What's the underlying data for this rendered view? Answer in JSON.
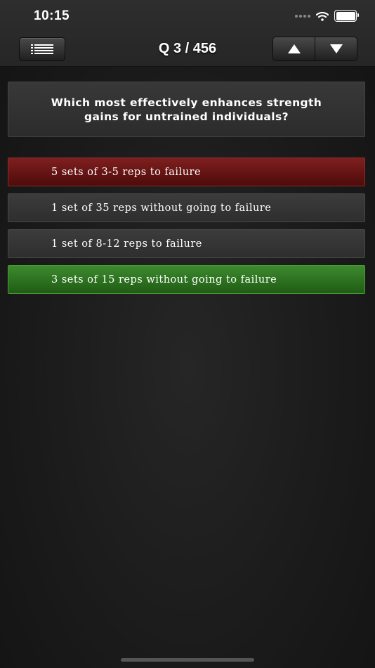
{
  "status_bar": {
    "time": "10:15",
    "icons": [
      "signal-dots-icon",
      "wifi-icon",
      "battery-icon"
    ]
  },
  "toolbar": {
    "menu_icon": "list-icon",
    "counter": "Q 3 / 456",
    "prev_icon": "up-arrow-icon",
    "next_icon": "down-arrow-icon"
  },
  "question": {
    "text": "Which most effectively enhances strength gains for untrained individuals?"
  },
  "answers": [
    {
      "label": "5 sets of 3-5 reps to failure",
      "state": "incorrect"
    },
    {
      "label": "1 set of 35 reps without going to failure",
      "state": "neutral"
    },
    {
      "label": "1 set of 8-12 reps to failure",
      "state": "neutral"
    },
    {
      "label": "3 sets of 15 reps without going to failure",
      "state": "correct"
    }
  ],
  "colors": {
    "incorrect": "#6a1414",
    "correct": "#2f7322",
    "neutral": "#353535",
    "background": "#1d1d1d"
  }
}
